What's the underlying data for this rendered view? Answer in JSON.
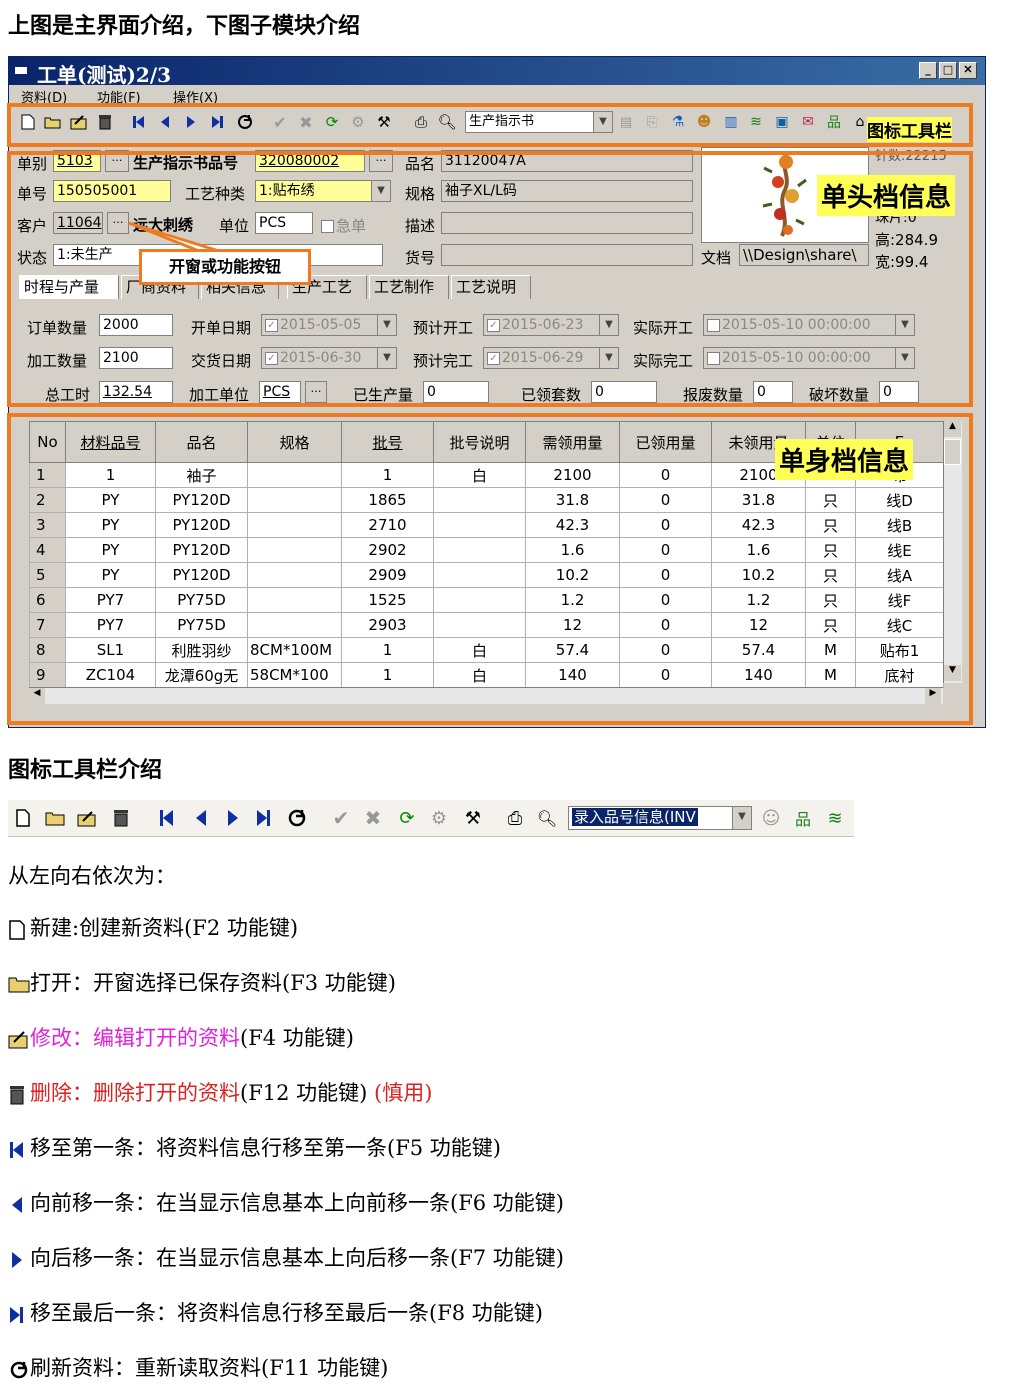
{
  "intro_heading": "上图是主界面介绍，下图子模块介绍",
  "window": {
    "title": "工单(测试)2/3",
    "menu": [
      "资料(D)",
      "功能(F)",
      "操作(X)"
    ],
    "toolbar_select": "生产指示书",
    "callouts": {
      "toolbar": "图标工具栏",
      "header": "单头档信息",
      "body": "单身档信息",
      "open_btn": "开窗或功能按钮"
    }
  },
  "header": {
    "danbie_label": "单别",
    "danbie_value": "5103",
    "product_no_label": "生产指示书品号",
    "product_no_value": "320080002",
    "pinming_label": "品名",
    "pinming_value": "31120047A",
    "danhao_label": "单号",
    "danhao_value": "150505001",
    "gongyi_label": "工艺种类",
    "gongyi_value": "1:贴布绣",
    "guige_label": "规格",
    "guige_value": "袖子XL/L码",
    "kehu_label": "客户",
    "kehu_value": "11064",
    "kehu_name": "远大刺绣",
    "danwei_label": "单位",
    "danwei_value": "PCS",
    "jidan_label": "急单",
    "miaoshu_label": "描述",
    "zhuangtai_label": "状态",
    "zhuangtai_value": "1:未生产",
    "huohao_label": "货号",
    "wendang_label": "文档",
    "wendang_value": "\\\\Design\\share\\",
    "stats": [
      "针数:22215",
      "珠片:0",
      "高:284.9",
      "宽:99.4"
    ]
  },
  "tabs": [
    "时程与产量",
    "厂商资料",
    "相关信息",
    "生产工艺",
    "工艺制作",
    "工艺说明"
  ],
  "schedule": {
    "dingdan_label": "订单数量",
    "dingdan_value": "2000",
    "kaidan_label": "开单日期",
    "kaidan_value": "2015-05-05",
    "yujikaigong_label": "预计开工",
    "yujikaigong_value": "2015-06-23",
    "shijikaigong_label": "实际开工",
    "shijikaigong_value": "2015-05-10 00:00:00",
    "jiagong_label": "加工数量",
    "jiagong_value": "2100",
    "jiaohuo_label": "交货日期",
    "jiaohuo_value": "2015-06-30",
    "yujiwangong_label": "预计完工",
    "yujiwangong_value": "2015-06-29",
    "shijiwangong_label": "实际完工",
    "shijiwangong_value": "2015-05-10 00:00:00",
    "zonggongshi_label": "总工时",
    "zonggongshi_value": "132.54",
    "jiagongdanwei_label": "加工单位",
    "jiagongdanwei_value": "PCS",
    "yishengchan_label": "已生产量",
    "yishengchan_value": "0",
    "yilingtao_label": "已领套数",
    "yilingtao_value": "0",
    "baofei_label": "报废数量",
    "baofei_value": "0",
    "posun_label": "破坏数量",
    "posun_value": "0"
  },
  "grid": {
    "columns": [
      "No",
      "材料品号",
      "品名",
      "规格",
      "批号",
      "批号说明",
      "需领用量",
      "已领用量",
      "未领用量",
      "单位",
      "E"
    ],
    "rows": [
      [
        "1",
        "1",
        "袖子",
        "",
        "1",
        "白",
        "2100",
        "0",
        "2100",
        "PCS",
        "布"
      ],
      [
        "2",
        "PY",
        "PY120D",
        "",
        "1865",
        "",
        "31.8",
        "0",
        "31.8",
        "只",
        "线D"
      ],
      [
        "3",
        "PY",
        "PY120D",
        "",
        "2710",
        "",
        "42.3",
        "0",
        "42.3",
        "只",
        "线B"
      ],
      [
        "4",
        "PY",
        "PY120D",
        "",
        "2902",
        "",
        "1.6",
        "0",
        "1.6",
        "只",
        "线E"
      ],
      [
        "5",
        "PY",
        "PY120D",
        "",
        "2909",
        "",
        "10.2",
        "0",
        "10.2",
        "只",
        "线A"
      ],
      [
        "6",
        "PY7",
        "PY75D",
        "",
        "1525",
        "",
        "1.2",
        "0",
        "1.2",
        "只",
        "线F"
      ],
      [
        "7",
        "PY7",
        "PY75D",
        "",
        "2903",
        "",
        "12",
        "0",
        "12",
        "只",
        "线C"
      ],
      [
        "8",
        "SL1",
        "利胜羽纱",
        "8CM*100M",
        "1",
        "白",
        "57.4",
        "0",
        "57.4",
        "M",
        "贴布1"
      ],
      [
        "9",
        "ZC104",
        "龙潭60g无",
        "58CM*100",
        "1",
        "白",
        "140",
        "0",
        "140",
        "M",
        "底衬"
      ]
    ]
  },
  "toolbar_section": {
    "heading": "图标工具栏介绍",
    "select_value": "录入品号信息(INV"
  },
  "order_text": "从左向右依次为：",
  "items": [
    {
      "name": "新建:创建新资料",
      "key": "(F2 功能键)",
      "extra": ""
    },
    {
      "name": "打开：开窗选择已保存资料",
      "key": "(F3 功能键)",
      "extra": ""
    },
    {
      "name": "修改：编辑打开的资料",
      "key": "(F4 功能键)",
      "extra": ""
    },
    {
      "name": "删除：删除打开的资料",
      "key": "(F12 功能键) ",
      "extra": "(慎用)"
    },
    {
      "name": "移至第一条：将资料信息行移至第一条",
      "key": "(F5 功能键)",
      "extra": ""
    },
    {
      "name": "向前移一条：在当显示信息基本上向前移一条",
      "key": "(F6 功能键)",
      "extra": ""
    },
    {
      "name": "向后移一条：在当显示信息基本上向后移一条",
      "key": "(F7 功能键)",
      "extra": ""
    },
    {
      "name": "移至最后一条：将资料信息行移至最后一条",
      "key": "(F8 功能键)",
      "extra": ""
    },
    {
      "name": "刷新资料：重新读取资料",
      "key": "(F11 功能键)",
      "extra": ""
    }
  ],
  "colors": {
    "orange": "#F07A20",
    "magenta": "#E020E0",
    "red": "#E02020",
    "navy": "#0A246A"
  }
}
